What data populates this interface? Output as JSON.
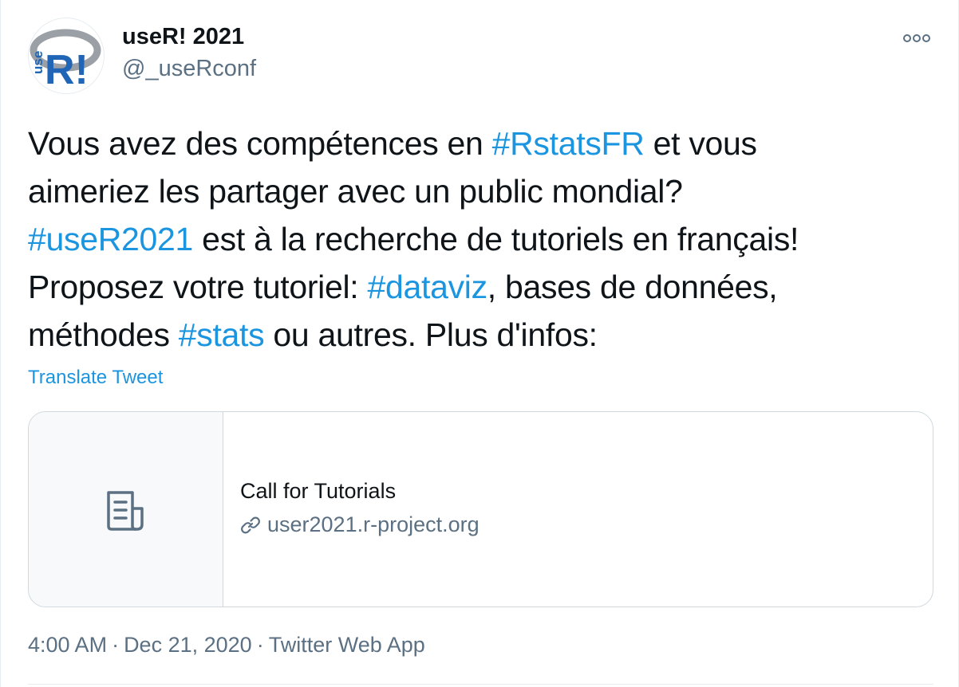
{
  "author": {
    "display_name": "useR! 2021",
    "handle": "@_useRconf",
    "avatar_icon": "user-r-logo-icon",
    "avatar_text": "useR!"
  },
  "more_icon": "more-options-icon",
  "tweet": {
    "lines": [
      [
        {
          "text": "Vous avez des compétences en "
        },
        {
          "text": "#RstatsFR",
          "hashtag": true
        },
        {
          "text": " et vous"
        }
      ],
      [
        {
          "text": "aimeriez les partager avec un public mondial?"
        }
      ],
      [
        {
          "text": "#useR2021",
          "hashtag": true
        },
        {
          "text": " est à la recherche de tutoriels en français!"
        }
      ],
      [
        {
          "text": "Proposez votre tutoriel: "
        },
        {
          "text": "#dataviz",
          "hashtag": true
        },
        {
          "text": ", bases de données,"
        }
      ],
      [
        {
          "text": "méthodes "
        },
        {
          "text": "#stats",
          "hashtag": true
        },
        {
          "text": " ou autres. Plus d'infos:"
        }
      ]
    ],
    "translate_label": "Translate Tweet"
  },
  "card": {
    "thumbnail_icon": "document-icon",
    "title": "Call for Tutorials",
    "link_icon": "link-icon",
    "url": "user2021.r-project.org"
  },
  "meta": {
    "time": "4:00 AM",
    "separator": "·",
    "date": "Dec 21, 2020",
    "source": "Twitter Web App"
  },
  "colors": {
    "hashtag": "#1b95e0",
    "secondary_text": "#5b7083",
    "primary_text": "#0f1419",
    "border": "#cfd9de"
  }
}
